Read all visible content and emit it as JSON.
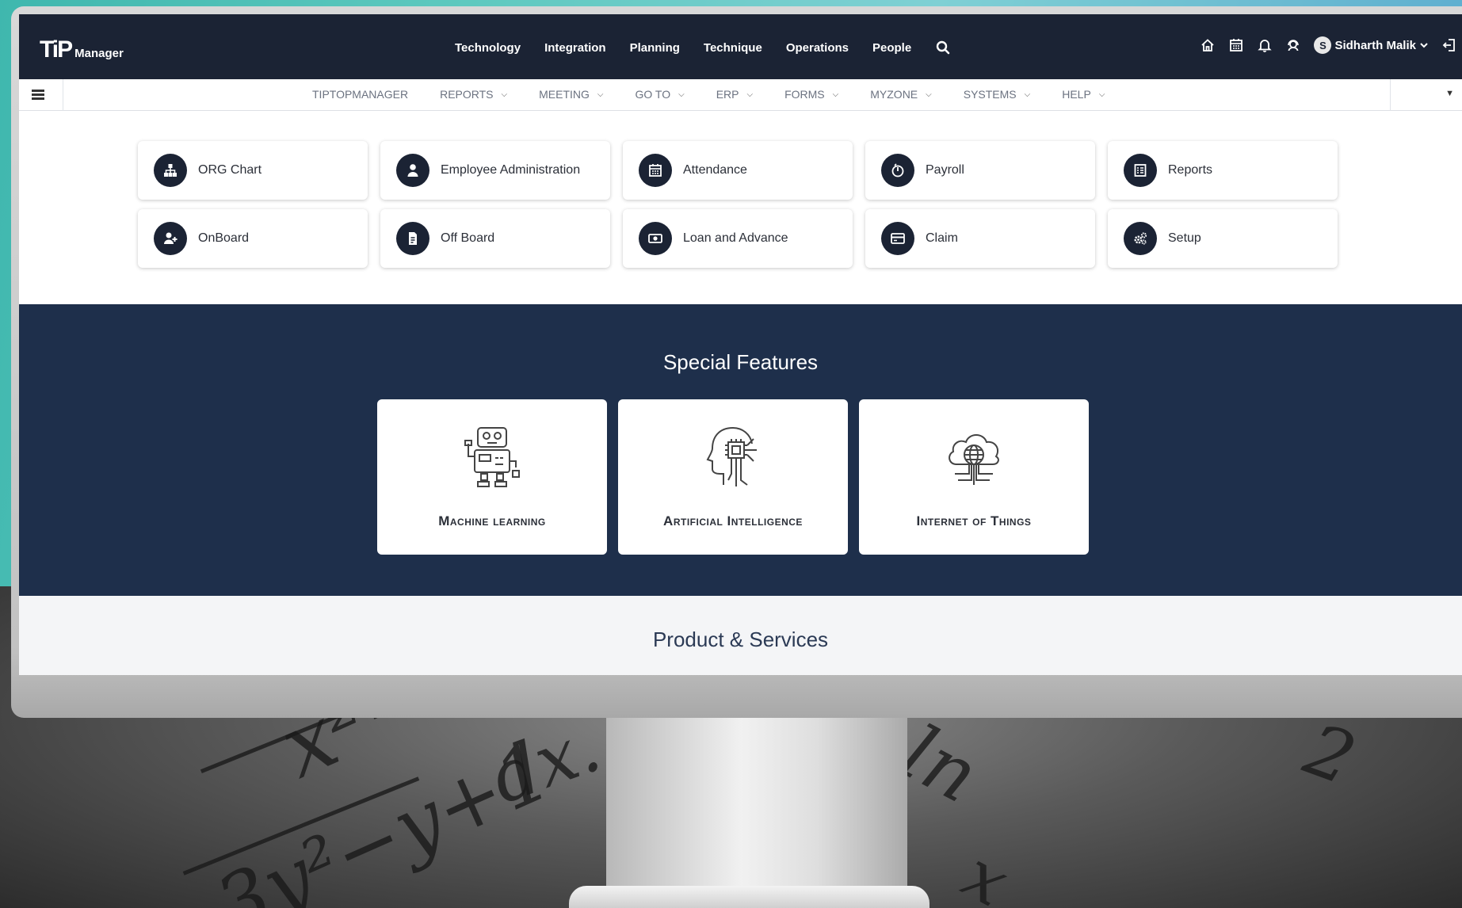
{
  "header": {
    "logo_mark": "TiP",
    "logo_sub": "Manager",
    "nav": [
      "Technology",
      "Integration",
      "Planning",
      "Technique",
      "Operations",
      "People"
    ],
    "user_initial": "S",
    "user_name": "Sidharth Malik"
  },
  "icons": {
    "search": "search-icon",
    "home": "home-icon",
    "calendar": "calendar-icon",
    "bell": "bell-icon",
    "support": "support-icon",
    "logout": "logout-icon"
  },
  "submenu": {
    "items": [
      {
        "label": "TIPTOPMANAGER",
        "dropdown": false
      },
      {
        "label": "REPORTS",
        "dropdown": true
      },
      {
        "label": "MEETING",
        "dropdown": true
      },
      {
        "label": "GO TO",
        "dropdown": true
      },
      {
        "label": "ERP",
        "dropdown": true
      },
      {
        "label": "FORMS",
        "dropdown": true
      },
      {
        "label": "MYZONE",
        "dropdown": true
      },
      {
        "label": "SYSTEMS",
        "dropdown": true
      },
      {
        "label": "HELP",
        "dropdown": true
      }
    ]
  },
  "tiles": [
    {
      "label": "ORG Chart",
      "icon": "org-chart-icon"
    },
    {
      "label": "Employee Administration",
      "icon": "employee-icon"
    },
    {
      "label": "Attendance",
      "icon": "calendar-icon"
    },
    {
      "label": "Payroll",
      "icon": "payroll-icon"
    },
    {
      "label": "Reports",
      "icon": "reports-icon"
    },
    {
      "label": "OnBoard",
      "icon": "user-add-icon"
    },
    {
      "label": "Off Board",
      "icon": "document-icon"
    },
    {
      "label": "Loan and Advance",
      "icon": "money-icon"
    },
    {
      "label": "Claim",
      "icon": "card-icon"
    },
    {
      "label": "Setup",
      "icon": "gears-icon"
    }
  ],
  "special_features": {
    "title": "Special Features",
    "items": [
      {
        "label": "Machine learning",
        "icon": "robot-icon"
      },
      {
        "label": "Artificial Intelligence",
        "icon": "ai-head-icon"
      },
      {
        "label": "Internet of Things",
        "icon": "iot-cloud-icon"
      }
    ]
  },
  "products": {
    "title": "Product & Services"
  },
  "colors": {
    "navy": "#1b2334",
    "features_bg": "#1e2f4b",
    "teal_bg": "#5ec9bf"
  }
}
